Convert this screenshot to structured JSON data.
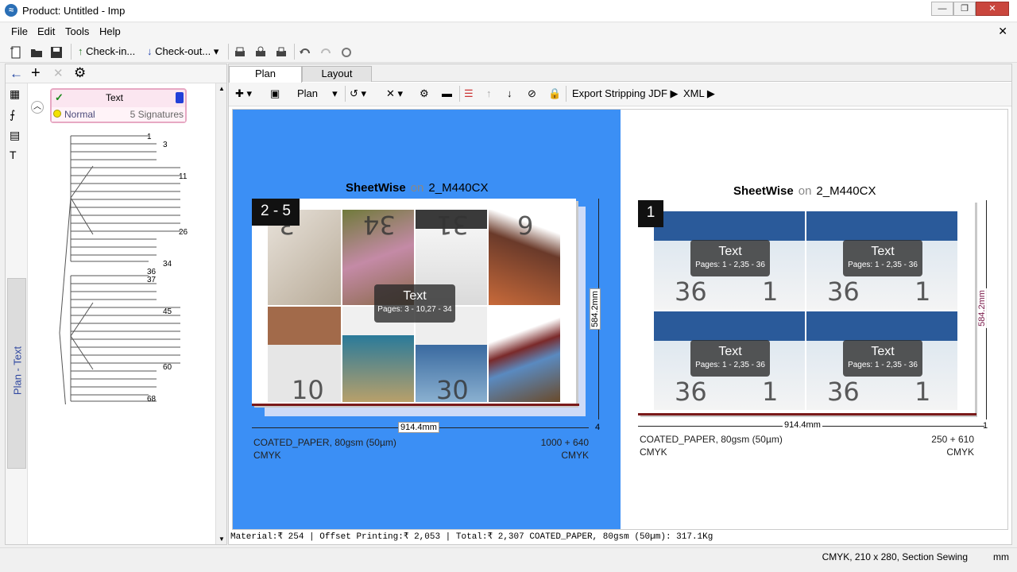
{
  "window": {
    "title": "Product: Untitled - Imp"
  },
  "menu": [
    "File",
    "Edit",
    "Tools",
    "Help"
  ],
  "toolbar": {
    "checkin": "Check-in...",
    "checkout": "Check-out..."
  },
  "tabs": [
    "Plan",
    "Layout"
  ],
  "plan_toolbar": {
    "plan_select": "Plan",
    "export": "Export Stripping JDF",
    "xml": "XML"
  },
  "job": {
    "name": "Text",
    "status": "Normal",
    "signatures": "5 Signatures"
  },
  "side_tab": "Plan - Text",
  "tree_labels": [
    "1",
    "3",
    "11",
    "26",
    "34",
    "36",
    "37",
    "45",
    "60",
    "68"
  ],
  "sheet_a": {
    "title": "SheetWise",
    "on": "on",
    "device": "2_M440CX",
    "badge": "2 - 5",
    "overlay_title": "Text",
    "overlay_pages": "Pages: 3 - 10,27 - 34",
    "width_label": "914.4mm",
    "height_label": "584.2mm",
    "count": "4",
    "material": "COATED_PAPER, 80gsm (50µm)",
    "color": "CMYK",
    "qty": "1000 + 640",
    "color2": "CMYK",
    "page_numbers": [
      "3",
      "34",
      "31",
      "6",
      "10",
      "30"
    ]
  },
  "sheet_b": {
    "title": "SheetWise",
    "on": "on",
    "device": "2_M440CX",
    "badge": "1",
    "overlay_title": "Text",
    "overlay_pages": "Pages: 1 - 2,35 - 36",
    "width_label": "914.4mm",
    "height_label": "584.2mm",
    "count": "1",
    "material": "COATED_PAPER, 80gsm (50µm)",
    "color": "CMYK",
    "qty": "250 + 610",
    "color2": "CMYK",
    "page_numbers": [
      "36",
      "1"
    ]
  },
  "costs": "Material:₹ 254 | Offset Printing:₹ 2,053 | Total:₹ 2,307   COATED_PAPER, 80gsm (50µm): 317.1Kg",
  "status": {
    "info": "CMYK, 210 x 280, Section Sewing",
    "unit": "mm"
  },
  "colors": {
    "sheet_bg": "#3b8ff5",
    "accent": "#7a1a1a"
  }
}
